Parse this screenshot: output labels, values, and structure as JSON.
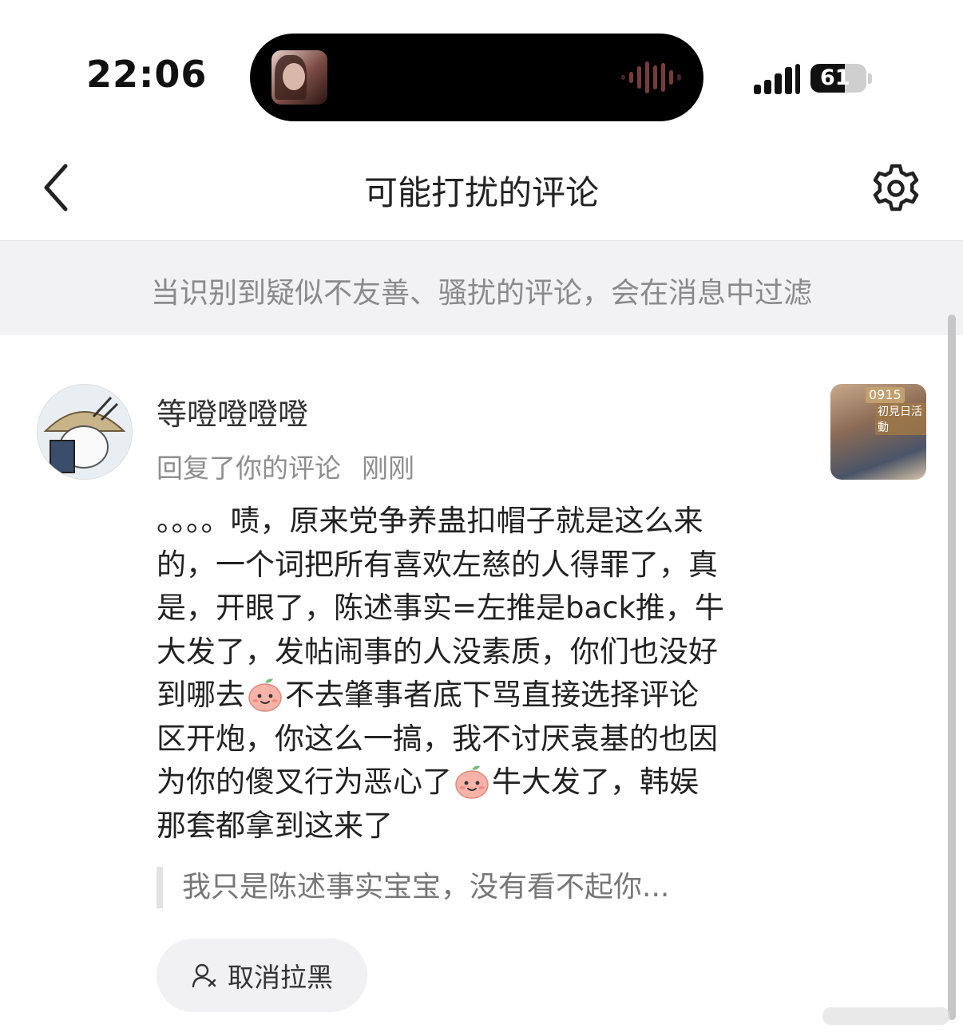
{
  "status_bar": {
    "time": "22:06",
    "battery": "61",
    "battery_level": 0.61
  },
  "nav": {
    "title": "可能打扰的评论",
    "back_icon": "chevron-left-icon",
    "settings_icon": "gear-icon"
  },
  "banner": {
    "text": "当识别到疑似不友善、骚扰的评论，会在消息中过滤"
  },
  "comment": {
    "username": "等噔噔噔噔",
    "action": "回复了你的评论",
    "time": "刚刚",
    "thumbnail_badge": "0915",
    "thumbnail_caption": "初見日活動",
    "body": [
      "。。。。啧，原来党争养蛊扣帽子就是这么来",
      "的，一个词把所有喜欢左慈的人得罪了，真",
      "是，开眼了，陈述事实=左推是back推，牛",
      "大发了，发帖闹事的人没素质，你们也没好",
      "到哪去",
      "不去肇事者底下骂直接选择评论",
      "区开炮，你这么一搞，我不讨厌袁基的也因",
      "为你的傻叉行为恶心了",
      "牛大发了，韩娱",
      "那套都拿到这来了"
    ],
    "quoted": "我只是陈述事实宝宝，没有看不起你...",
    "unblock_label": "取消拉黑"
  },
  "colors": {
    "banner_bg": "#f2f2f4",
    "muted_text": "#8e8e8e",
    "button_bg": "#f1f1f3"
  }
}
